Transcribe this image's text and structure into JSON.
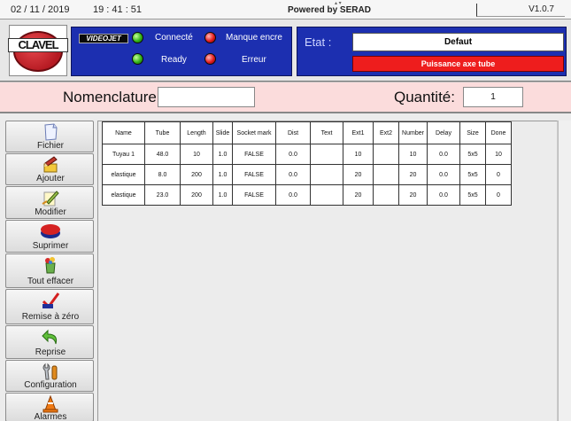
{
  "topbar": {
    "date": "02 / 11 / 2019",
    "time": "19 : 41 : 51",
    "powered_by": "Powered by SERAD",
    "version": "V1.0.7"
  },
  "header": {
    "logo_text": "CLAVEL",
    "videojet_logo": "VIDEOJET",
    "indicators": [
      {
        "label": "Connecté",
        "state": "on",
        "color": "#32b316"
      },
      {
        "label": "Manque encre",
        "state": "on",
        "color": "#e21c1c"
      },
      {
        "label": "Ready",
        "state": "on",
        "color": "#32b316"
      },
      {
        "label": "Erreur",
        "state": "on",
        "color": "#e21c1c"
      }
    ],
    "etat_label": "Etat :",
    "etat_value": "Defaut",
    "etat_error": "Puissance axe tube"
  },
  "form": {
    "nomenclature_label": "Nomenclature:",
    "nomenclature_value": "",
    "quantite_label": "Quantité:",
    "quantite_value": "1"
  },
  "sidebar": {
    "items": [
      {
        "label": "Fichier",
        "icon": "file-icon"
      },
      {
        "label": "Ajouter",
        "icon": "pencil-add-icon"
      },
      {
        "label": "Modifier",
        "icon": "edit-icon"
      },
      {
        "label": "Suprimer",
        "icon": "eraser-icon"
      },
      {
        "label": "Tout effacer",
        "icon": "recycle-bin-icon"
      },
      {
        "label": "Remise à zéro",
        "icon": "reset-check-icon"
      },
      {
        "label": "Reprise",
        "icon": "return-arrow-icon"
      },
      {
        "label": "Configuration",
        "icon": "tools-icon"
      },
      {
        "label": "Alarmes",
        "icon": "cone-icon"
      }
    ]
  },
  "table": {
    "columns": [
      "Name",
      "Tube",
      "Length",
      "Slide",
      "Socket mark",
      "Dist",
      "Text",
      "Ext1",
      "Ext2",
      "Number",
      "Delay",
      "Size",
      "Done"
    ],
    "rows": [
      [
        "Tuyau 1",
        "48.0",
        "10",
        "1.0",
        "FALSE",
        "0.0",
        "",
        "10",
        "",
        "10",
        "0.0",
        "5x5",
        "10"
      ],
      [
        "elastique",
        "8.0",
        "200",
        "1.0",
        "FALSE",
        "0.0",
        "",
        "20",
        "",
        "20",
        "0.0",
        "5x5",
        "0"
      ],
      [
        "elastique",
        "23.0",
        "200",
        "1.0",
        "FALSE",
        "0.0",
        "",
        "20",
        "",
        "20",
        "0.0",
        "5x5",
        "0"
      ]
    ]
  },
  "colors": {
    "panel_blue": "#1c2fb0",
    "error_red": "#ee1d1d",
    "nomenclature_bg": "#fbdcdc"
  }
}
